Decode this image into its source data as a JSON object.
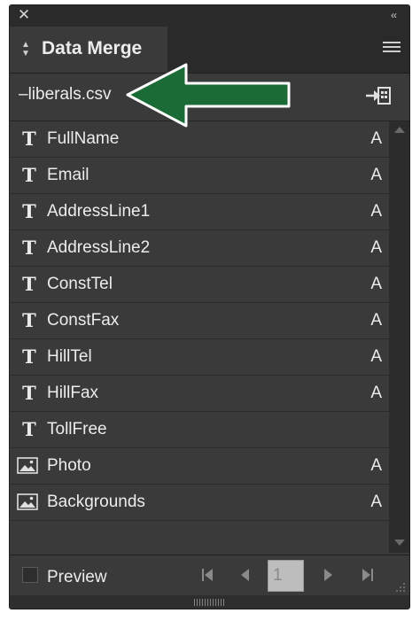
{
  "panel": {
    "title": "Data Merge",
    "close_icon": "close-icon",
    "collapse_icon": "double-chevron-left-icon",
    "menu_icon": "hamburger-menu-icon"
  },
  "data_source": {
    "filename": "–liberals.csv",
    "import_icon": "import-data-icon"
  },
  "fields": [
    {
      "label": "FullName",
      "type": "text",
      "icon": "text-field-icon",
      "badge": "A"
    },
    {
      "label": "Email",
      "type": "text",
      "icon": "text-field-icon",
      "badge": "A"
    },
    {
      "label": "AddressLine1",
      "type": "text",
      "icon": "text-field-icon",
      "badge": "A"
    },
    {
      "label": "AddressLine2",
      "type": "text",
      "icon": "text-field-icon",
      "badge": "A"
    },
    {
      "label": "ConstTel",
      "type": "text",
      "icon": "text-field-icon",
      "badge": "A"
    },
    {
      "label": "ConstFax",
      "type": "text",
      "icon": "text-field-icon",
      "badge": "A"
    },
    {
      "label": "HillTel",
      "type": "text",
      "icon": "text-field-icon",
      "badge": "A"
    },
    {
      "label": "HillFax",
      "type": "text",
      "icon": "text-field-icon",
      "badge": "A"
    },
    {
      "label": "TollFree",
      "type": "text",
      "icon": "text-field-icon",
      "badge": ""
    },
    {
      "label": "Photo",
      "type": "image",
      "icon": "image-field-icon",
      "badge": "A"
    },
    {
      "label": "Backgrounds",
      "type": "image",
      "icon": "image-field-icon",
      "badge": "A"
    }
  ],
  "footer": {
    "preview_label": "Preview",
    "preview_checked": false,
    "page_number": "1"
  },
  "colors": {
    "panel_bg": "#3a3a3a",
    "text": "#ececec",
    "arrow_fill": "#1a6b35"
  }
}
